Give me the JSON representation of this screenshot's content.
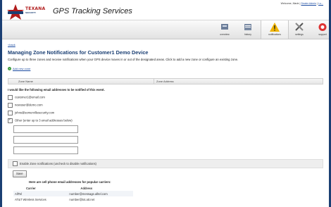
{
  "header": {
    "logo_text": "TEXANA",
    "logo_sub": "SECURITY",
    "app_title": "GPS Tracking Services",
    "welcome_text": "Welcome, Marie |",
    "dealer_admin_link": "Dealer Admin",
    "logout_link": "Lo..."
  },
  "tabs": [
    {
      "label": "overview",
      "icon": "overview-icon"
    },
    {
      "label": "history",
      "icon": "history-icon"
    },
    {
      "label": "notifications",
      "icon": "warning-icon",
      "active": true
    },
    {
      "label": "settings",
      "icon": "tools-icon"
    },
    {
      "label": "support",
      "icon": "lifebuoy-icon"
    }
  ],
  "page": {
    "back_link": "<back",
    "title": "Managing Zone Notifications for Customer1 Demo Device",
    "intro": "Configure up to three zones and receive notifications when your GPS device moves in or out of the designated areas. Click to add a new zone or configure an existing zone.",
    "add_zone_link": "Add new zone"
  },
  "zone_table": {
    "columns": [
      "Zone Name",
      "Zone Address"
    ]
  },
  "notify": {
    "label": "I would like the following email addresses to be notified of this event.",
    "emails": [
      {
        "address": "customer1@email.com",
        "checked": false
      },
      {
        "address": "newuser@demo.com",
        "checked": false
      },
      {
        "address": "johns@somervillesecurity.com",
        "checked": false
      }
    ],
    "other_label": "Other (enter up to 3 email addresses below)",
    "other_checked": true,
    "other_inputs": [
      "",
      "",
      ""
    ]
  },
  "enable_label": "Enable Zone notifications (uncheck to disable notifications)",
  "save_label": "Save",
  "carriers": {
    "heading": "Here are cell phone email addresses for popular carriers:",
    "columns": [
      "Carrier",
      "Address"
    ],
    "rows": [
      {
        "carrier": "AllTel",
        "address": "number@message.alltel.com"
      },
      {
        "carrier": "AT&T Wireless Services",
        "address": "number@txt.att.net"
      }
    ]
  },
  "colors": {
    "accent": "#1b3f73",
    "link": "#1a4aa0",
    "background": "#1b3f73"
  }
}
